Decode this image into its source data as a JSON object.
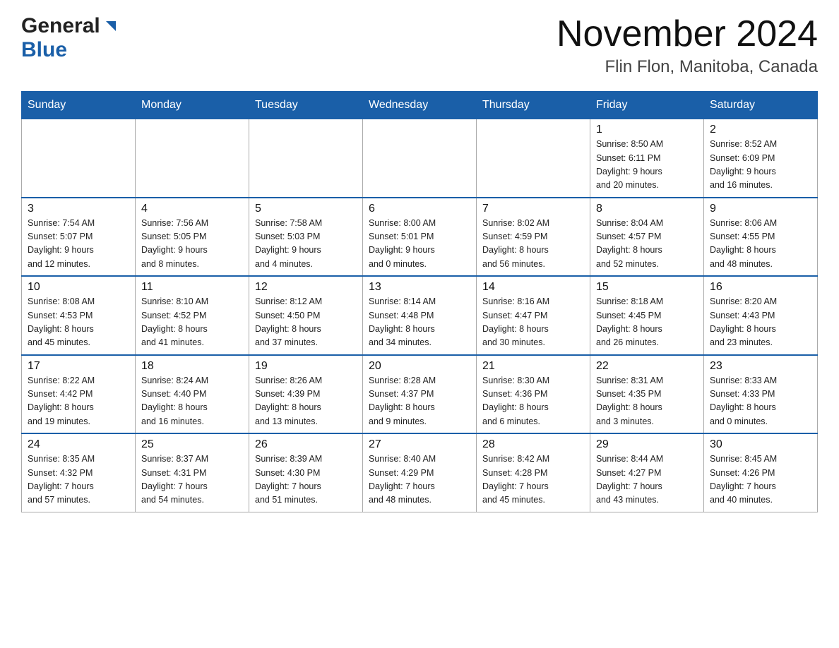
{
  "header": {
    "logo_general": "General",
    "logo_blue": "Blue",
    "month_title": "November 2024",
    "location": "Flin Flon, Manitoba, Canada"
  },
  "weekdays": [
    "Sunday",
    "Monday",
    "Tuesday",
    "Wednesday",
    "Thursday",
    "Friday",
    "Saturday"
  ],
  "weeks": [
    {
      "days": [
        {
          "num": "",
          "info": ""
        },
        {
          "num": "",
          "info": ""
        },
        {
          "num": "",
          "info": ""
        },
        {
          "num": "",
          "info": ""
        },
        {
          "num": "",
          "info": ""
        },
        {
          "num": "1",
          "info": "Sunrise: 8:50 AM\nSunset: 6:11 PM\nDaylight: 9 hours\nand 20 minutes."
        },
        {
          "num": "2",
          "info": "Sunrise: 8:52 AM\nSunset: 6:09 PM\nDaylight: 9 hours\nand 16 minutes."
        }
      ]
    },
    {
      "days": [
        {
          "num": "3",
          "info": "Sunrise: 7:54 AM\nSunset: 5:07 PM\nDaylight: 9 hours\nand 12 minutes."
        },
        {
          "num": "4",
          "info": "Sunrise: 7:56 AM\nSunset: 5:05 PM\nDaylight: 9 hours\nand 8 minutes."
        },
        {
          "num": "5",
          "info": "Sunrise: 7:58 AM\nSunset: 5:03 PM\nDaylight: 9 hours\nand 4 minutes."
        },
        {
          "num": "6",
          "info": "Sunrise: 8:00 AM\nSunset: 5:01 PM\nDaylight: 9 hours\nand 0 minutes."
        },
        {
          "num": "7",
          "info": "Sunrise: 8:02 AM\nSunset: 4:59 PM\nDaylight: 8 hours\nand 56 minutes."
        },
        {
          "num": "8",
          "info": "Sunrise: 8:04 AM\nSunset: 4:57 PM\nDaylight: 8 hours\nand 52 minutes."
        },
        {
          "num": "9",
          "info": "Sunrise: 8:06 AM\nSunset: 4:55 PM\nDaylight: 8 hours\nand 48 minutes."
        }
      ]
    },
    {
      "days": [
        {
          "num": "10",
          "info": "Sunrise: 8:08 AM\nSunset: 4:53 PM\nDaylight: 8 hours\nand 45 minutes."
        },
        {
          "num": "11",
          "info": "Sunrise: 8:10 AM\nSunset: 4:52 PM\nDaylight: 8 hours\nand 41 minutes."
        },
        {
          "num": "12",
          "info": "Sunrise: 8:12 AM\nSunset: 4:50 PM\nDaylight: 8 hours\nand 37 minutes."
        },
        {
          "num": "13",
          "info": "Sunrise: 8:14 AM\nSunset: 4:48 PM\nDaylight: 8 hours\nand 34 minutes."
        },
        {
          "num": "14",
          "info": "Sunrise: 8:16 AM\nSunset: 4:47 PM\nDaylight: 8 hours\nand 30 minutes."
        },
        {
          "num": "15",
          "info": "Sunrise: 8:18 AM\nSunset: 4:45 PM\nDaylight: 8 hours\nand 26 minutes."
        },
        {
          "num": "16",
          "info": "Sunrise: 8:20 AM\nSunset: 4:43 PM\nDaylight: 8 hours\nand 23 minutes."
        }
      ]
    },
    {
      "days": [
        {
          "num": "17",
          "info": "Sunrise: 8:22 AM\nSunset: 4:42 PM\nDaylight: 8 hours\nand 19 minutes."
        },
        {
          "num": "18",
          "info": "Sunrise: 8:24 AM\nSunset: 4:40 PM\nDaylight: 8 hours\nand 16 minutes."
        },
        {
          "num": "19",
          "info": "Sunrise: 8:26 AM\nSunset: 4:39 PM\nDaylight: 8 hours\nand 13 minutes."
        },
        {
          "num": "20",
          "info": "Sunrise: 8:28 AM\nSunset: 4:37 PM\nDaylight: 8 hours\nand 9 minutes."
        },
        {
          "num": "21",
          "info": "Sunrise: 8:30 AM\nSunset: 4:36 PM\nDaylight: 8 hours\nand 6 minutes."
        },
        {
          "num": "22",
          "info": "Sunrise: 8:31 AM\nSunset: 4:35 PM\nDaylight: 8 hours\nand 3 minutes."
        },
        {
          "num": "23",
          "info": "Sunrise: 8:33 AM\nSunset: 4:33 PM\nDaylight: 8 hours\nand 0 minutes."
        }
      ]
    },
    {
      "days": [
        {
          "num": "24",
          "info": "Sunrise: 8:35 AM\nSunset: 4:32 PM\nDaylight: 7 hours\nand 57 minutes."
        },
        {
          "num": "25",
          "info": "Sunrise: 8:37 AM\nSunset: 4:31 PM\nDaylight: 7 hours\nand 54 minutes."
        },
        {
          "num": "26",
          "info": "Sunrise: 8:39 AM\nSunset: 4:30 PM\nDaylight: 7 hours\nand 51 minutes."
        },
        {
          "num": "27",
          "info": "Sunrise: 8:40 AM\nSunset: 4:29 PM\nDaylight: 7 hours\nand 48 minutes."
        },
        {
          "num": "28",
          "info": "Sunrise: 8:42 AM\nSunset: 4:28 PM\nDaylight: 7 hours\nand 45 minutes."
        },
        {
          "num": "29",
          "info": "Sunrise: 8:44 AM\nSunset: 4:27 PM\nDaylight: 7 hours\nand 43 minutes."
        },
        {
          "num": "30",
          "info": "Sunrise: 8:45 AM\nSunset: 4:26 PM\nDaylight: 7 hours\nand 40 minutes."
        }
      ]
    }
  ]
}
